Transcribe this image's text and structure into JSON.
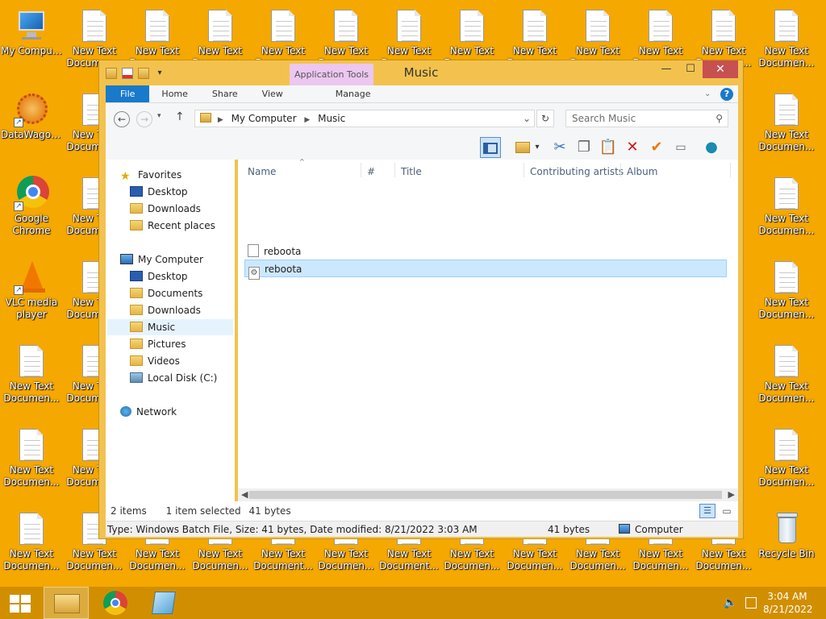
{
  "desktop": {
    "icons": [
      {
        "label": "My Computer"
      },
      {
        "label": "DataWagon..."
      },
      {
        "label": "Google Chrome"
      },
      {
        "label": "VLC media player"
      },
      {
        "label": "New Text Documen..."
      },
      {
        "label": "Recycle Bin"
      },
      {
        "label": "New Text Document..."
      }
    ]
  },
  "window": {
    "title": "Music",
    "context_tab": "Application Tools",
    "ribbon_tabs": [
      "File",
      "Home",
      "Share",
      "View",
      "Manage"
    ],
    "address": {
      "root": "My Computer",
      "current": "Music"
    },
    "search_placeholder": "Search Music",
    "nav": {
      "favorites": "Favorites",
      "fav_items": [
        "Desktop",
        "Downloads",
        "Recent places"
      ],
      "computer": "My Computer",
      "computer_items": [
        "Desktop",
        "Documents",
        "Downloads",
        "Music",
        "Pictures",
        "Videos",
        "Local Disk (C:)"
      ],
      "network": "Network"
    },
    "columns": [
      "Name",
      "#",
      "Title",
      "Contributing artists",
      "Album"
    ],
    "files": [
      {
        "name": "reboota",
        "selected": false
      },
      {
        "name": "reboota",
        "selected": true
      }
    ],
    "status": {
      "count": "2 items",
      "selection": "1 item selected",
      "size": "41 bytes"
    },
    "details": {
      "info": "Type: Windows Batch File, Size: 41 bytes, Date modified: 8/21/2022 3:03 AM",
      "size": "41 bytes",
      "location": "Computer"
    }
  },
  "taskbar": {
    "time": "3:04 AM",
    "date": "8/21/2022"
  },
  "colors": {
    "desktop_bg": "#f5a800",
    "window_frame": "#f3c24e",
    "file_tab": "#1979ca",
    "close_button": "#c75050",
    "selection": "#cce8ff"
  }
}
